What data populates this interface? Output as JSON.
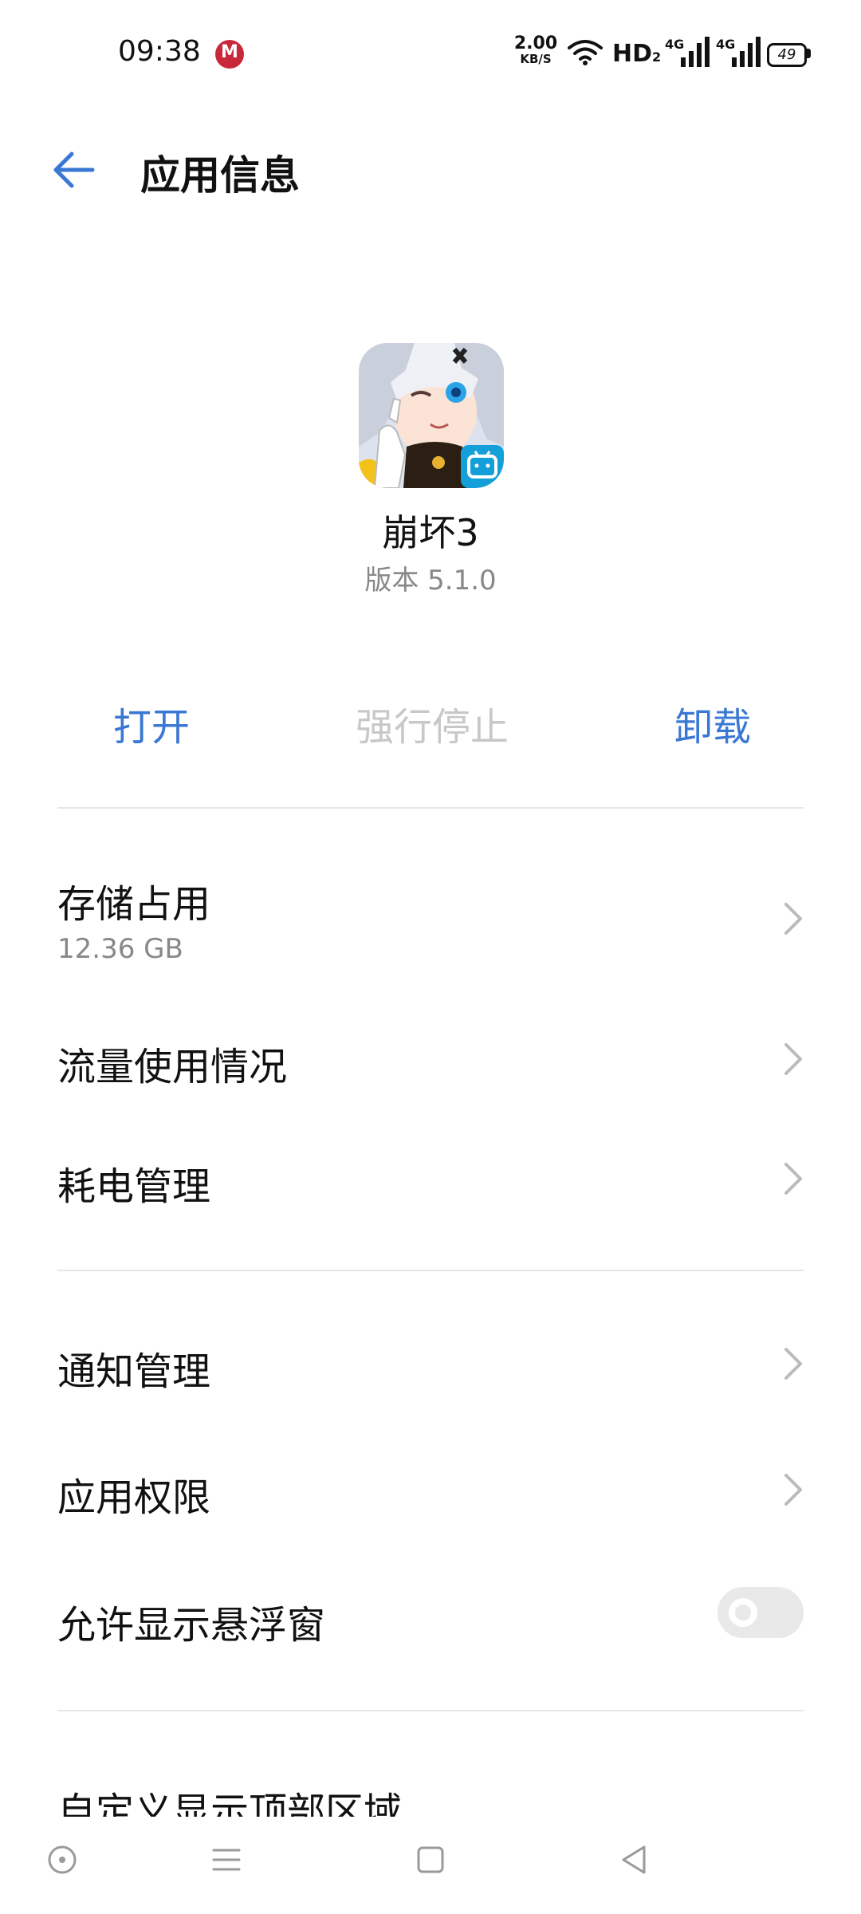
{
  "status_bar": {
    "time": "09:38",
    "net_speed_value": "2.00",
    "net_speed_unit": "KB/S",
    "hd_label": "HD",
    "hd_sub": "2",
    "signal1_label": "4G",
    "signal2_label": "4G",
    "battery": "49"
  },
  "header": {
    "title": "应用信息"
  },
  "app": {
    "name": "崩坏3",
    "version": "版本 5.1.0"
  },
  "actions": {
    "open": "打开",
    "force_stop": "强行停止",
    "uninstall": "卸载"
  },
  "settings": {
    "storage_label": "存储占用",
    "storage_value": "12.36 GB",
    "data_usage_label": "流量使用情况",
    "battery_label": "耗电管理",
    "notifications_label": "通知管理",
    "permissions_label": "应用权限",
    "floating_window_label": "允许显示悬浮窗",
    "floating_window_enabled": false,
    "custom_top_area_label": "自定义显示顶部区域"
  },
  "colors": {
    "accent": "#3a78d4",
    "disabled": "#c8c8c8",
    "secondary_text": "#888888"
  }
}
